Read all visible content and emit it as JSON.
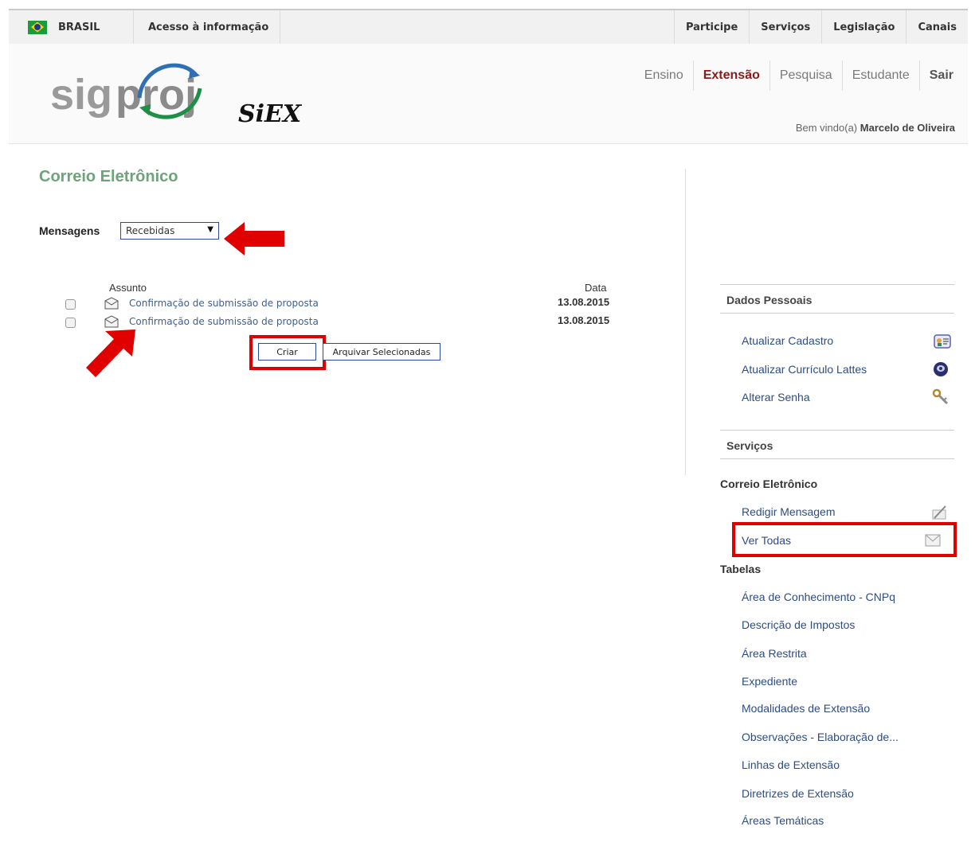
{
  "gov_bar": {
    "brasil": "BRASIL",
    "acesso": "Acesso à informação",
    "links": [
      "Participe",
      "Serviços",
      "Legislação",
      "Canais"
    ]
  },
  "header": {
    "logo_text": "sigproj",
    "logo_sub": "SIEX",
    "nav": [
      "Ensino",
      "Extensão",
      "Pesquisa",
      "Estudante",
      "Sair"
    ],
    "active_nav": "Extensão",
    "welcome_prefix": "Bem vindo(a)",
    "user_name": "Marcelo de Oliveira"
  },
  "main": {
    "title": "Correio Eletrônico",
    "messages_label": "Mensagens",
    "messages_select": "Recebidas",
    "col_subject": "Assunto",
    "col_date": "Data",
    "rows": [
      {
        "subject": "Confirmação de submissão de proposta",
        "date": "13.08.2015"
      },
      {
        "subject": "Confirmação de submissão de proposta",
        "date": "13.08.2015"
      }
    ],
    "btn_create": "Criar",
    "btn_archive": "Arquivar Selecionadas"
  },
  "sidebar": {
    "dados_title": "Dados Pessoais",
    "dados_links": [
      "Atualizar Cadastro",
      "Atualizar Currículo Lattes",
      "Alterar Senha"
    ],
    "servicos_title": "Serviços",
    "correio_title": "Correio Eletrônico",
    "correio_links": [
      "Redigir Mensagem",
      "Ver Todas"
    ],
    "tabelas_title": "Tabelas",
    "tabelas_links": [
      "Área de Conhecimento - CNPq",
      "Descrição de Impostos",
      "Área Restrita",
      "Expediente",
      "Modalidades de Extensão",
      "Observações - Elaboração de...",
      "Linhas de Extensão",
      "Diretrizes de Extensão",
      "Áreas Temáticas"
    ]
  },
  "colors": {
    "title_green": "#6fa37a",
    "active_red": "#8b1a1a",
    "link_blue": "#2c4d84",
    "highlight_red": "#e00000"
  }
}
